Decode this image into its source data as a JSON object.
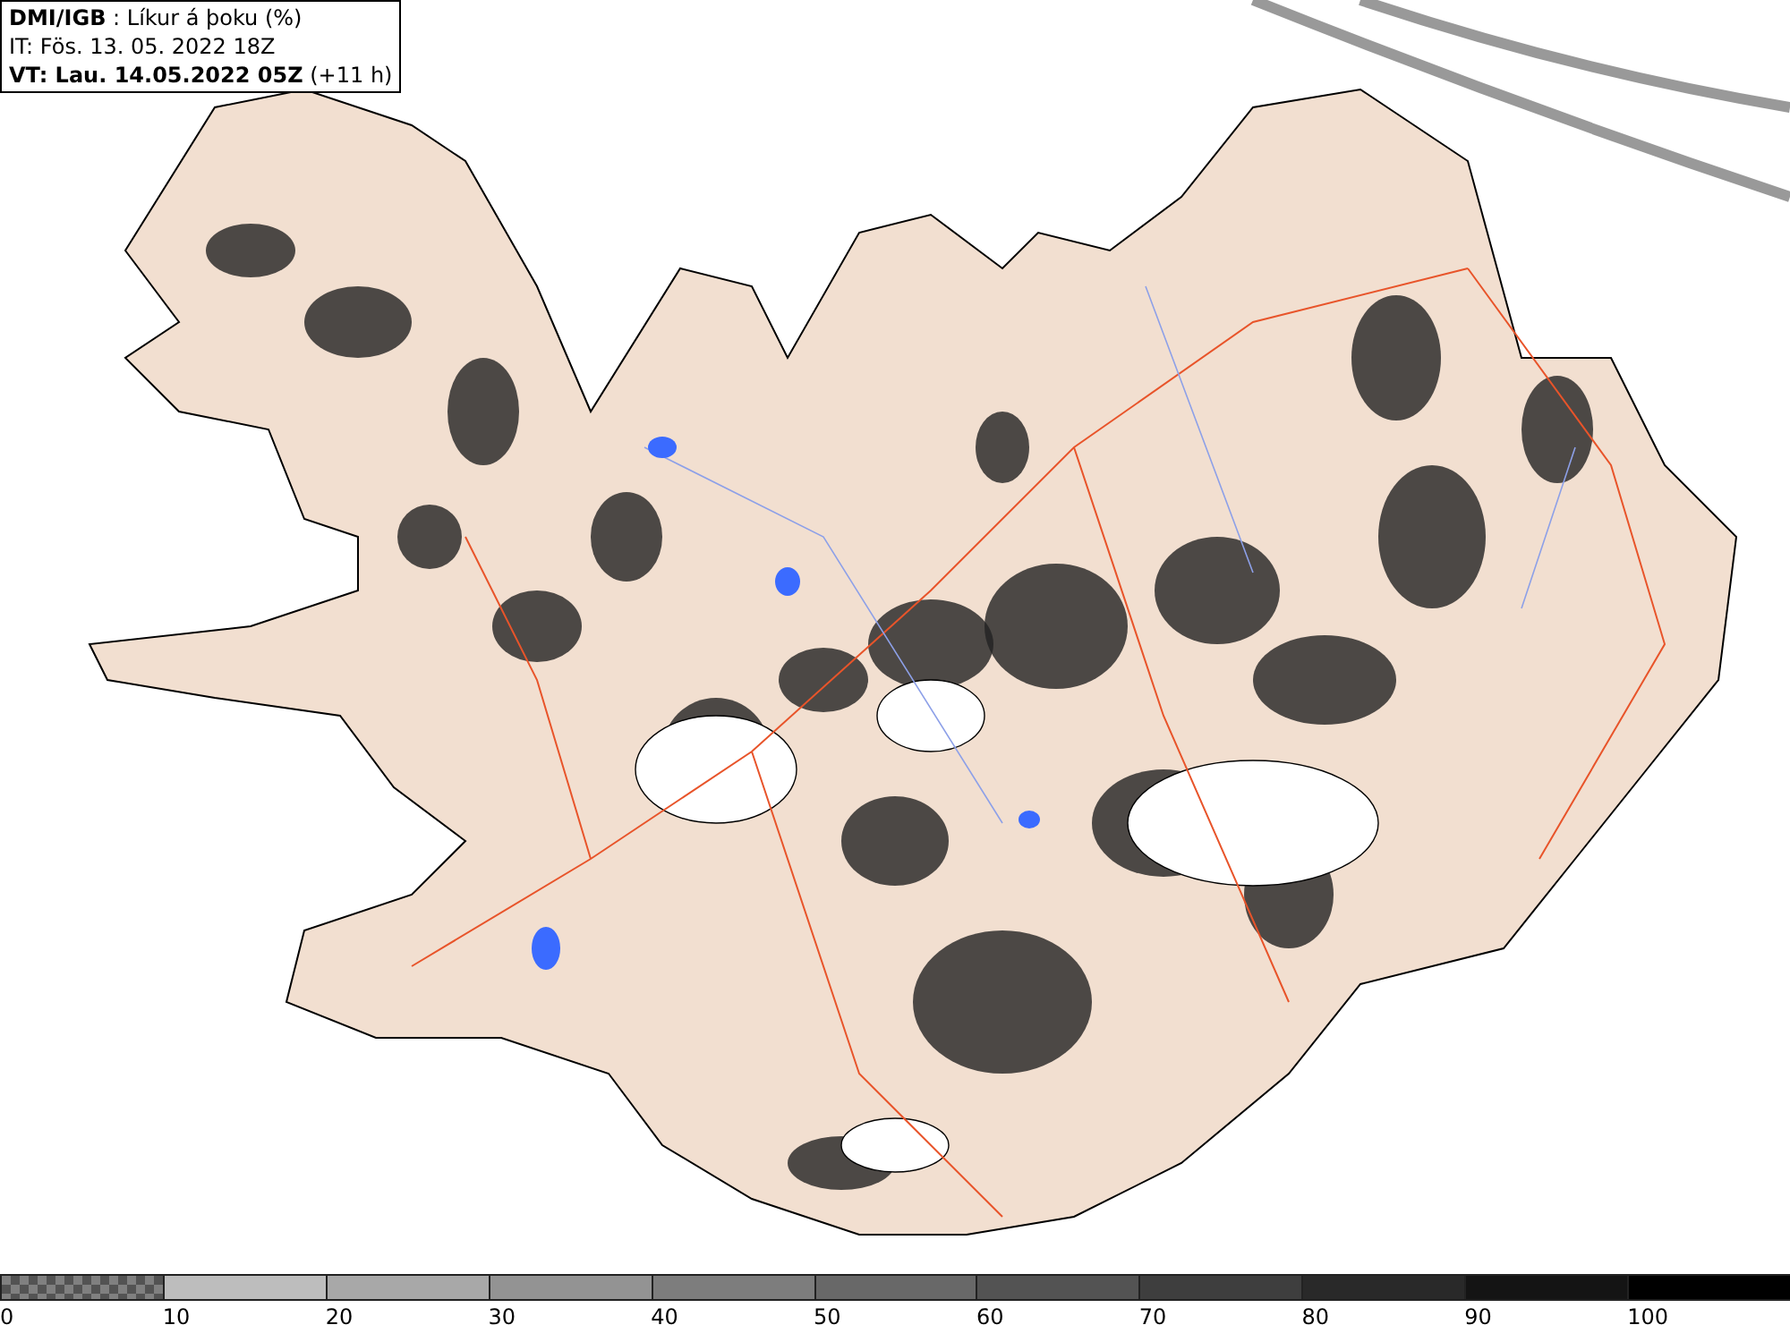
{
  "header": {
    "lines": [
      "**DMI/IGB** : Líkur á þoku (%)",
      "IT: Fös. 13. 05. 2022 18Z",
      "**VT: Lau. 14.05.2022 05Z** (+11 h)"
    ]
  },
  "legend": {
    "segments": [
      {
        "kind": "checkered",
        "color": "#808080",
        "label": "0"
      },
      {
        "kind": "solid",
        "color": "#bdbdbd",
        "label": "10"
      },
      {
        "kind": "solid",
        "color": "#a8a8a8",
        "label": "20"
      },
      {
        "kind": "solid",
        "color": "#939393",
        "label": "30"
      },
      {
        "kind": "solid",
        "color": "#7d7d7d",
        "label": "40"
      },
      {
        "kind": "solid",
        "color": "#686868",
        "label": "50"
      },
      {
        "kind": "solid",
        "color": "#535353",
        "label": "60"
      },
      {
        "kind": "solid",
        "color": "#3e3e3e",
        "label": "70"
      },
      {
        "kind": "solid",
        "color": "#292929",
        "label": "80"
      },
      {
        "kind": "solid",
        "color": "#141414",
        "label": "90"
      },
      {
        "kind": "solid",
        "color": "#000000",
        "label": "100"
      }
    ]
  }
}
